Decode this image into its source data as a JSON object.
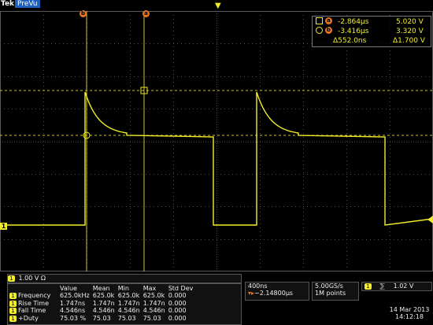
{
  "brand": {
    "name": "Tek",
    "mode": "PreVu"
  },
  "colors": {
    "trace": "#f2ed2a",
    "cursor": "#e8741e",
    "grid": "#4a4a4a",
    "cursor_line": "#c7c23a"
  },
  "cursor_readout": {
    "a": {
      "time": "-2.864µs",
      "volts": "5.020 V"
    },
    "b": {
      "time": "-3.416µs",
      "volts": "3.320 V"
    },
    "delta": {
      "time": "Δ552.0ns",
      "volts": "Δ1.700 V"
    }
  },
  "cursor_labels": {
    "a": "a",
    "b": "b"
  },
  "channel": {
    "marker": "1",
    "scale": "1.00 V",
    "coupling": "Ω"
  },
  "measurements": {
    "headers": [
      "Value",
      "Mean",
      "Min",
      "Max",
      "Std Dev"
    ],
    "rows": [
      {
        "label": "Frequency",
        "cells": [
          "625.0kHz",
          "625.0k",
          "625.0k",
          "625.0k",
          "0.000"
        ]
      },
      {
        "label": "Rise Time",
        "cells": [
          "1.747ns",
          "1.747n",
          "1.747n",
          "1.747n",
          "0.000"
        ]
      },
      {
        "label": "Fall Time",
        "cells": [
          "4.546ns",
          "4.546n",
          "4.546n",
          "4.546n",
          "0.000"
        ]
      },
      {
        "label": "+Duty",
        "cells": [
          "75.03 %",
          "75.03",
          "75.03",
          "75.03",
          "0.000"
        ]
      }
    ]
  },
  "timebase": {
    "scale": "400ns",
    "position": "−2.14800µs"
  },
  "acquisition": {
    "rate": "5.00GS/s",
    "points": "1M points"
  },
  "trigger": {
    "source": "1",
    "slope": "⅀",
    "level": "1.02 V"
  },
  "timestamp": {
    "date": "14 Mar 2013",
    "time": "14:12:18"
  }
}
